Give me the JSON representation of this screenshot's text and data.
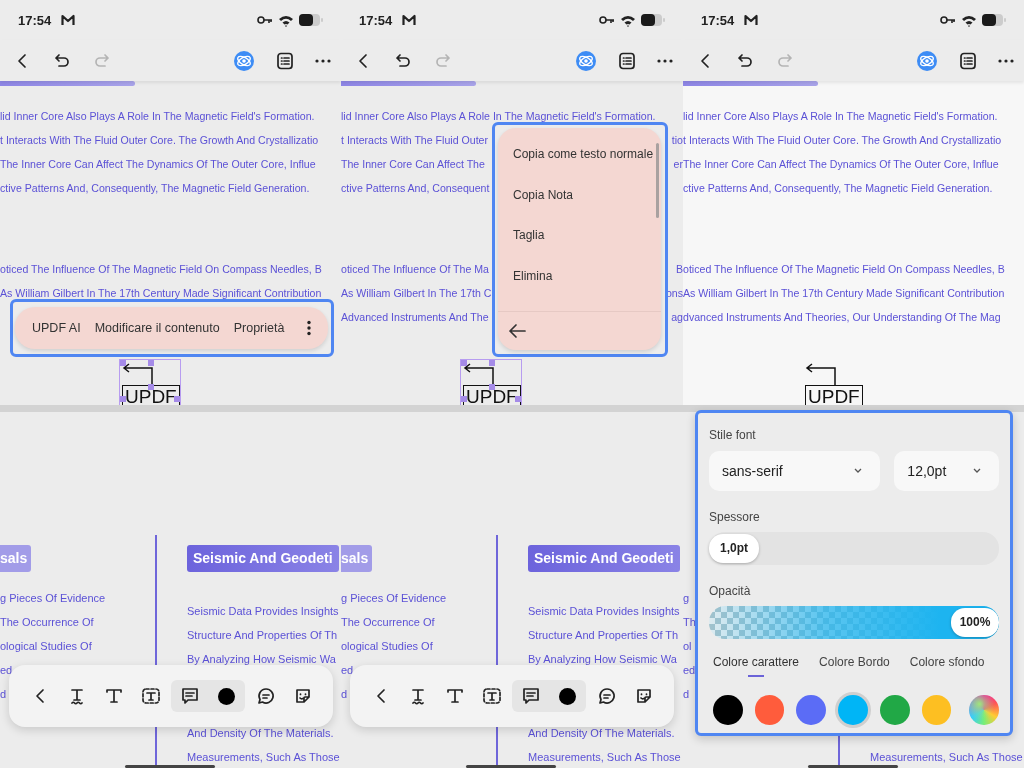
{
  "panels": [
    {
      "status_bar": {
        "time": "17:54"
      },
      "toolbar": {
        "redo": {
          "disabled": true
        }
      },
      "page_top": {
        "paragraphs": [
          [
            {
              "text": "lid Inner Core Also Plays A Role In The Magnetic Field's Formation."
            },
            {
              "text": "t Interacts With The Fluid Outer Core. The Growth And Crystallizatio"
            },
            {
              "text": "The Inner Core Can Affect The Dynamics Of The Outer Core, Influe"
            },
            {
              "text": "ctive Patterns And, Consequently, The Magnetic Field Generation."
            }
          ],
          [
            {
              "text": "oticed The Influence Of The Magnetic Field On Compass Needles, B"
            },
            {
              "text": "As William Gilbert In The 17th Century Made Significant Contribution"
            }
          ]
        ],
        "diagram": {
          "label": "UPDF",
          "selected": true
        }
      },
      "page_bottom": {
        "left_badge": "sals",
        "left_lines": [
          "g Pieces Of Evidence",
          "The Occurrence Of",
          "ological Studies Of",
          "ed",
          "d"
        ],
        "right_badge": "Seismic And Geodeti",
        "right_lines_top": [
          "Seismic Data Provides Insights",
          "Structure And Properties Of Th",
          "By Analyzing How Seismic Wa"
        ],
        "right_lines_bottom": [
          "And Density Of The Materials.",
          "Measurements, Such As Those"
        ]
      },
      "overlay": {
        "kind": "action_bar",
        "items": [
          {
            "label": "UPDF AI"
          },
          {
            "label": "Modificare il contenuto"
          },
          {
            "label": "Proprietà"
          }
        ]
      },
      "bottom_toolbar": {
        "tools": [
          {
            "kind": "back",
            "selected": false
          },
          {
            "kind": "squiggly",
            "selected": false
          },
          {
            "kind": "text",
            "selected": false
          },
          {
            "kind": "textbox",
            "selected": false
          },
          {
            "kind": "note",
            "selected": true
          },
          {
            "kind": "color",
            "color": "#000000",
            "selected": true
          },
          {
            "kind": "comment",
            "selected": false
          },
          {
            "kind": "sticker",
            "selected": false
          }
        ]
      }
    },
    {
      "status_bar": {
        "time": "17:54"
      },
      "toolbar": {
        "redo": {
          "disabled": true
        }
      },
      "page_top": {
        "paragraphs": [
          [
            {
              "text": "lid Inner Core Also Plays A Role In The Magnetic Field's Formation."
            },
            {
              "text": "t Interacts With The Fluid Outer",
              "tail": "tio"
            },
            {
              "text": "The Inner Core Can Affect The",
              "tail": "er"
            },
            {
              "text": "ctive Patterns And, Consequent"
            }
          ],
          [
            {
              "text": "oticed The Influence Of The Ma",
              "tail": "B"
            },
            {
              "text": "As William Gilbert In The 17th C",
              "tail": "ons"
            },
            {
              "text": "Advanced Instruments And The",
              "tail": "ag"
            }
          ]
        ],
        "diagram": {
          "label": "UPDF",
          "selected": true
        }
      },
      "page_bottom": {
        "left_badge": "sals",
        "left_lines": [
          "g Pieces Of Evidence",
          "The Occurrence Of",
          "ological Studies Of",
          "ed",
          "d"
        ],
        "right_badge": "Seismic And Geodeti",
        "right_lines_top": [
          "Seismic Data Provides Insights",
          "Structure And Properties Of Th",
          "By Analyzing How Seismic Wa"
        ],
        "right_lines_bottom": [
          "And Density Of The Materials.",
          "Measurements, Such As Those"
        ]
      },
      "overlay": {
        "kind": "context_menu",
        "items": [
          {
            "label": "Copia come testo normale"
          },
          {
            "label": "Copia Nota"
          },
          {
            "label": "Taglia"
          },
          {
            "label": "Elimina"
          }
        ]
      },
      "bottom_toolbar": {
        "tools": [
          {
            "kind": "back",
            "selected": false
          },
          {
            "kind": "squiggly",
            "selected": false
          },
          {
            "kind": "text",
            "selected": false
          },
          {
            "kind": "textbox",
            "selected": false
          },
          {
            "kind": "note",
            "selected": true
          },
          {
            "kind": "color",
            "color": "#000000",
            "selected": true
          },
          {
            "kind": "comment",
            "selected": false
          },
          {
            "kind": "sticker",
            "selected": false
          }
        ]
      }
    },
    {
      "status_bar": {
        "time": "17:54"
      },
      "toolbar": {
        "redo": {
          "disabled": true
        }
      },
      "page_top": {
        "paragraphs": [
          [
            {
              "text": "lid Inner Core Also Plays A Role In The Magnetic Field's Formation."
            },
            {
              "text": "t Interacts With The Fluid Outer Core. The Growth And Crystallizatio"
            },
            {
              "text": "The Inner Core Can Affect The Dynamics Of The Outer Core, Influe"
            },
            {
              "text": "ctive Patterns And, Consequently, The Magnetic Field Generation."
            }
          ],
          [
            {
              "text": "oticed The Influence Of The Magnetic Field On Compass Needles, B"
            },
            {
              "text": "As William Gilbert In The 17th Century Made Significant Contribution"
            },
            {
              "text": "dvanced Instruments And Theories, Our Understanding Of The Mag"
            }
          ]
        ],
        "diagram": {
          "label": "UPDF",
          "selected": false
        }
      },
      "page_bottom": {
        "left_lines": [
          "g",
          "Th",
          "ol",
          "ed",
          "d"
        ],
        "right_lines_bottom": [
          "Measurements, Such As Those"
        ]
      },
      "overlay": {
        "kind": "properties_sheet",
        "font_label": "Stile font",
        "font": "sans-serif",
        "size": "12,0pt",
        "weight_label": "Spessore",
        "weight": {
          "reading": "1,0pt",
          "level": 0
        },
        "opacity_label": "Opacità",
        "opacity": {
          "reading": "100%",
          "level": 1
        },
        "tabs": [
          {
            "label": "Colore carattere",
            "selected": true
          },
          {
            "label": "Colore Bordo",
            "selected": false
          },
          {
            "label": "Colore sfondo",
            "selected": false
          }
        ],
        "swatches": [
          {
            "kind": "solid",
            "color": "#000000",
            "selected": false
          },
          {
            "kind": "solid",
            "color": "#ff5c3c",
            "selected": false
          },
          {
            "kind": "solid",
            "color": "#5b6cf6",
            "selected": false
          },
          {
            "kind": "solid",
            "color": "#00b5f6",
            "selected": true
          },
          {
            "kind": "solid",
            "color": "#21a846",
            "selected": false
          },
          {
            "kind": "solid",
            "color": "#fdbf22",
            "selected": false
          },
          {
            "kind": "custom",
            "selected": false
          }
        ]
      }
    }
  ]
}
